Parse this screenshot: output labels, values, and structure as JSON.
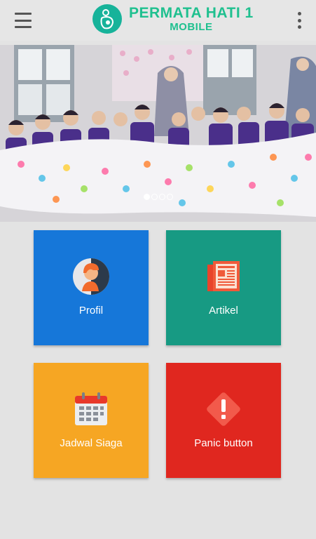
{
  "app": {
    "title": "PERMATA HATI 1",
    "subtitle": "MOBILE"
  },
  "icons": {
    "menu": "hamburger-menu-icon",
    "more": "more-vert-icon",
    "logo": "mother-baby-logo-icon"
  },
  "banner": {
    "slide_count": 4,
    "active_index": 0
  },
  "tiles": [
    {
      "label": "Profil",
      "color": "#1677d9",
      "icon": "profile-person-icon"
    },
    {
      "label": "Artikel",
      "color": "#179a83",
      "icon": "newspaper-icon"
    },
    {
      "label": "Jadwal Siaga",
      "color": "#f6a623",
      "icon": "calendar-icon"
    },
    {
      "label": "Panic button",
      "color": "#e0271f",
      "icon": "warning-diamond-icon"
    }
  ],
  "colors": {
    "brand": "#1fc08f",
    "background": "#e3e3e3",
    "appbar": "#e6e6e6"
  }
}
